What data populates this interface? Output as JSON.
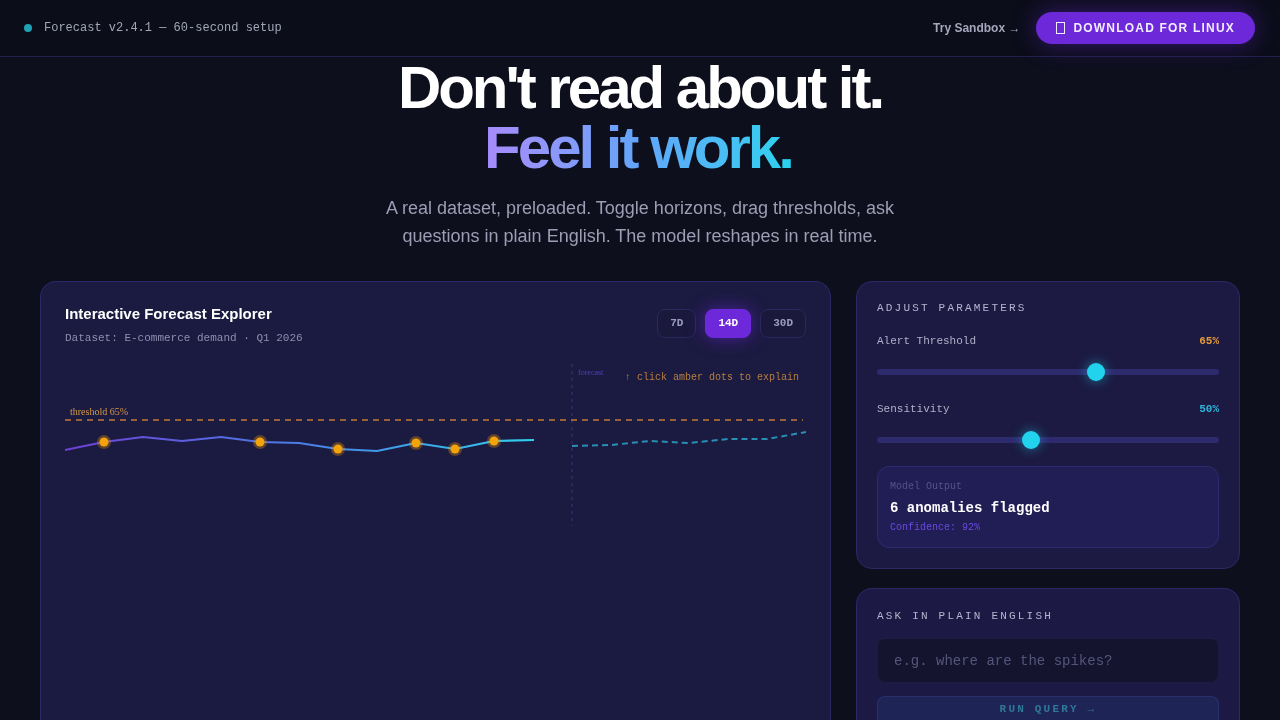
{
  "top_bar": {
    "status_text": "Forecast v2.4.1 — 60-second setup",
    "link": "Try Sandbox →",
    "button": "DOWNLOAD FOR LINUX"
  },
  "hero": {
    "title_line_1": "Don't read about it.",
    "title_line_2": "Feel it work.",
    "subtitle": "A real dataset, preloaded. Toggle horizons, drag thresholds, ask questions in plain English. The model reshapes in real time."
  },
  "explorer": {
    "title": "Interactive Forecast Explorer",
    "dataset": "Dataset: E-commerce demand · Q1 2026",
    "horizons": [
      {
        "label": "7D",
        "selected": false
      },
      {
        "label": "14D",
        "selected": true
      },
      {
        "label": "30D",
        "selected": false
      }
    ],
    "chart": {
      "threshold_label": "threshold 65%",
      "forecast_label": "forecast",
      "hint": "↑ click amber dots to explain"
    }
  },
  "parameters": {
    "title": "ADJUST PARAMETERS",
    "sliders": [
      {
        "label": "Alert Threshold",
        "reading": "65%",
        "color": "#e39a3b",
        "level": 0.64
      },
      {
        "label": "Sensitivity",
        "reading": "50%",
        "color": "#2cb5d9",
        "level": 0.45
      }
    ],
    "output": {
      "label": "Model Output",
      "result": "6 anomalies flagged",
      "confidence": "Confidence: 92%"
    }
  },
  "query": {
    "title": "ASK IN PLAIN ENGLISH",
    "placeholder": "e.g. where are the spikes?",
    "button": "RUN QUERY →"
  }
}
